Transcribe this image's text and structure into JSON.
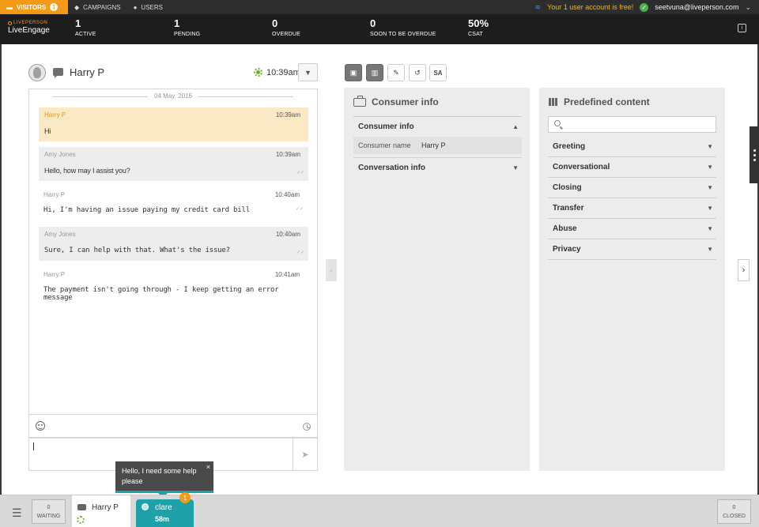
{
  "topnav": {
    "visitors_label": "VISITORS",
    "visitors_count": "1",
    "campaigns_label": "CAMPAIGNS",
    "users_label": "USERS",
    "free_notice": "Your 1 user account is free!",
    "account_email": "seetvuna@liveperson.com"
  },
  "brand": {
    "small": "LIVEPERSON",
    "big": "LiveEngage"
  },
  "stats": [
    {
      "value": "1",
      "label": "ACTIVE"
    },
    {
      "value": "1",
      "label": "PENDING"
    },
    {
      "value": "0",
      "label": "OVERDUE"
    },
    {
      "value": "0",
      "label": "SOON TO BE OVERDUE"
    },
    {
      "value": "50%",
      "label": "CSAT"
    }
  ],
  "chat": {
    "visitor_name": "Harry P",
    "time": "10:39am",
    "date": "04 May. 2016",
    "messages": [
      {
        "name": "Harry P",
        "time": "10:39am",
        "text": "Hi"
      },
      {
        "name": "Amy Jones",
        "time": "10:39am",
        "text": "Hello, how may I assist you?"
      },
      {
        "name": "Harry P",
        "time": "10:40am",
        "text": "Hi, I'm having an issue paying my credit card bill"
      },
      {
        "name": "Amy Jones",
        "time": "10:40am",
        "text": "Sure, I can help with that. What's the issue?"
      },
      {
        "name": "Harry P",
        "time": "10:41am",
        "text": "The payment isn't going through - I keep getting an error message"
      }
    ]
  },
  "toolbar": {
    "sa_label": "SA"
  },
  "consumer_panel": {
    "title": "Consumer info",
    "sections": [
      {
        "label": "Consumer info"
      },
      {
        "label": "Conversation info"
      }
    ],
    "fields": [
      {
        "key": "Consumer name",
        "value": "Harry P"
      }
    ]
  },
  "predefined_panel": {
    "title": "Predefined content",
    "search_placeholder": "",
    "categories": [
      "Greeting",
      "Conversational",
      "Closing",
      "Transfer",
      "Abuse",
      "Privacy"
    ]
  },
  "bottom": {
    "waiting_count": "0",
    "waiting_label": "WAITING",
    "closed_count": "0",
    "closed_label": "CLOSED",
    "tab_harry": "Harry P",
    "tab_clare_name": "clare",
    "tab_clare_time": "58m",
    "clare_badge": "1",
    "tooltip": "Hello, I need some help please"
  },
  "colors": {
    "accent_orange": "#f49a16",
    "teal": "#1ea1a9",
    "green": "#6ab42d"
  },
  "icons": [
    "chat-bubble-icon",
    "tag-icon",
    "user-icon",
    "layers-icon",
    "check-icon",
    "gear-icon",
    "briefcase-icon",
    "books-icon",
    "edit-icon",
    "history-icon",
    "emoji-icon",
    "clock-icon",
    "send-icon",
    "search-icon",
    "hamburger-icon"
  ]
}
